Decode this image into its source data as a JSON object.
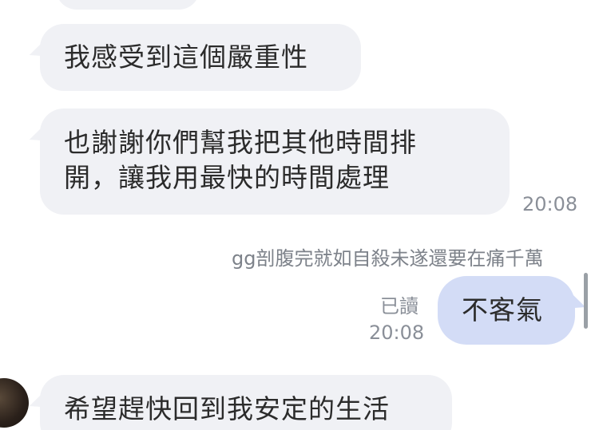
{
  "messages": [
    {
      "id": "m1",
      "direction": "incoming",
      "text": "我感受到這個嚴重性"
    },
    {
      "id": "m2",
      "direction": "incoming",
      "text": "也謝謝你們幫我把其他時間排\n開，讓我用最快的時間處理",
      "time": "20:08"
    },
    {
      "id": "m3",
      "direction": "outgoing",
      "text": "不客氣",
      "read_status": "已讀",
      "time": "20:08"
    },
    {
      "id": "m4",
      "direction": "incoming",
      "text": "希望趕快回到我安定的生活"
    }
  ],
  "overlay_comment": "gg剖腹完就如自殺未遂還要在痛千萬",
  "colors": {
    "incoming_bubble": "#f0f1f5",
    "outgoing_bubble": "#d3dcf6",
    "meta_text": "#8a8f98"
  }
}
